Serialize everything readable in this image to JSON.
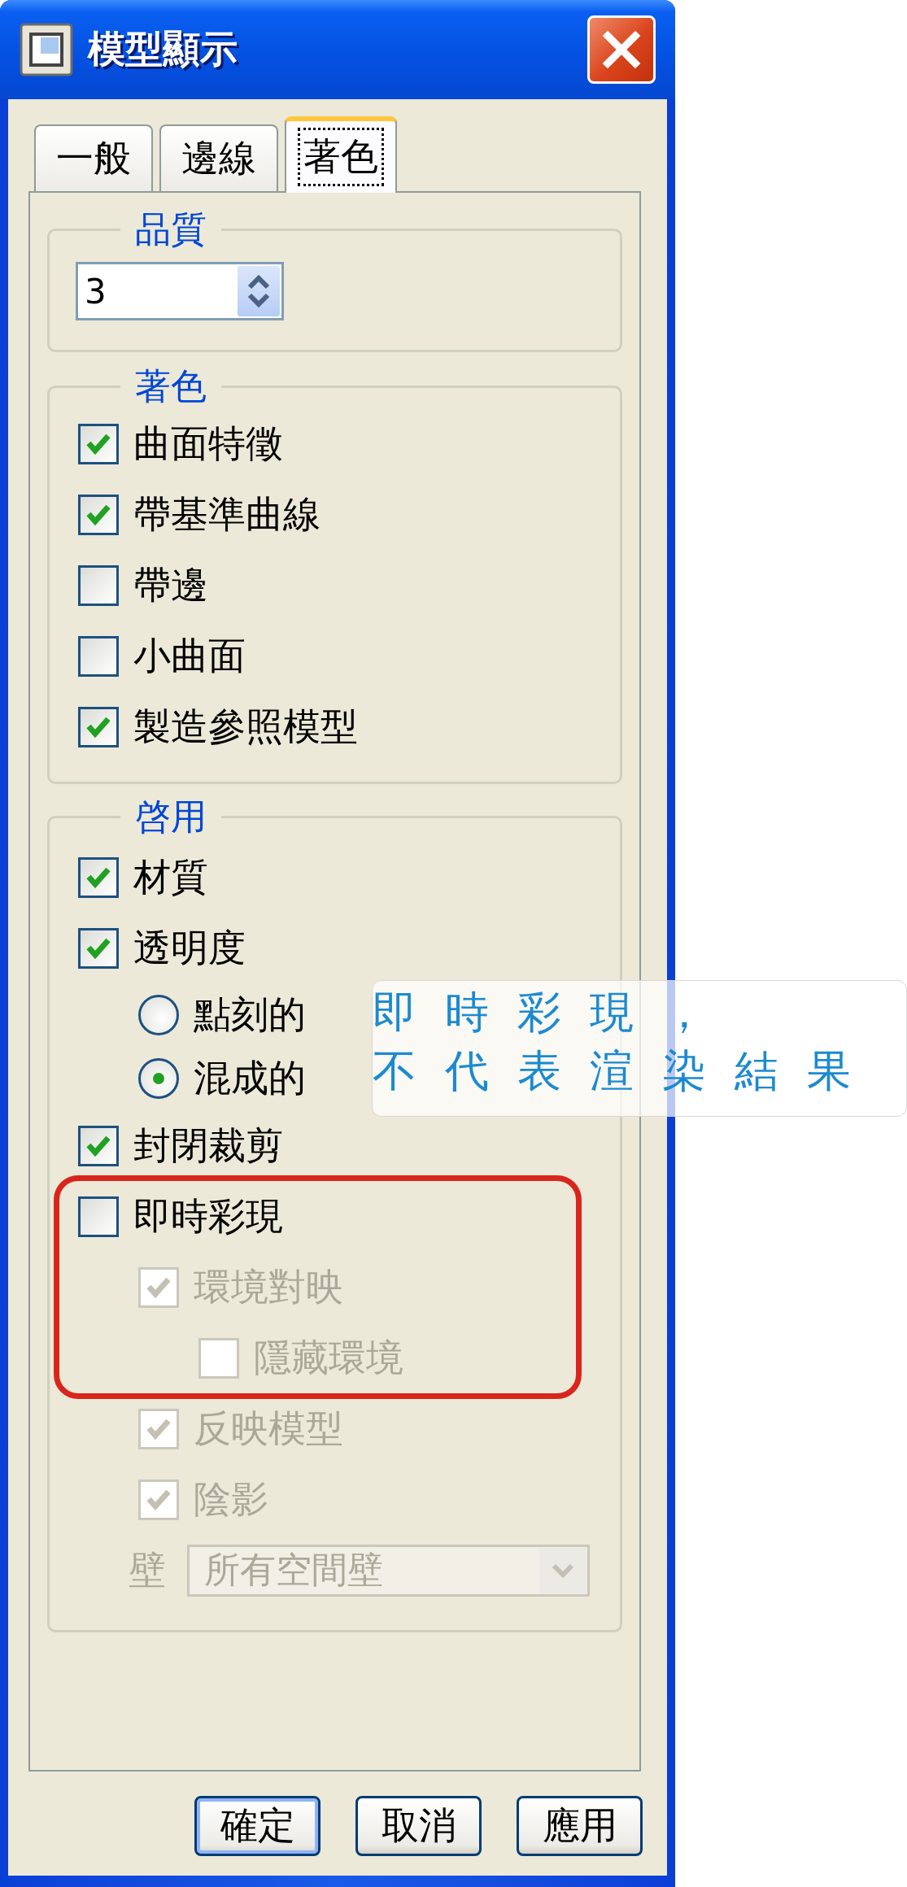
{
  "window": {
    "title": "模型顯示"
  },
  "tabs": [
    {
      "label": "一般",
      "selected": false
    },
    {
      "label": "邊線",
      "selected": false
    },
    {
      "label": "著色",
      "selected": true
    }
  ],
  "quality": {
    "legend": "品質",
    "value": "3"
  },
  "shading": {
    "legend": "著色",
    "items": [
      {
        "kind": "checkbox",
        "label": "曲面特徵",
        "checked": true,
        "disabled": false
      },
      {
        "kind": "checkbox",
        "label": "帶基準曲線",
        "checked": true,
        "disabled": false
      },
      {
        "kind": "checkbox",
        "label": "帶邊",
        "checked": false,
        "disabled": false
      },
      {
        "kind": "checkbox",
        "label": "小曲面",
        "checked": false,
        "disabled": false
      },
      {
        "kind": "checkbox",
        "label": "製造參照模型",
        "checked": true,
        "disabled": false
      }
    ]
  },
  "enable": {
    "legend": "啓用",
    "items": [
      {
        "kind": "checkbox",
        "label": "材質",
        "checked": true,
        "disabled": false,
        "highlighted": false
      },
      {
        "kind": "checkbox",
        "label": "透明度",
        "checked": true,
        "disabled": false,
        "highlighted": false,
        "children": [
          {
            "kind": "radio",
            "label": "點刻的",
            "selected": false,
            "disabled": false,
            "highlighted": false
          },
          {
            "kind": "radio",
            "label": "混成的",
            "selected": true,
            "disabled": false,
            "highlighted": false
          }
        ]
      },
      {
        "kind": "checkbox",
        "label": "封閉裁剪",
        "checked": true,
        "disabled": false,
        "highlighted": false
      },
      {
        "kind": "checkbox",
        "label": "即時彩現",
        "checked": false,
        "disabled": false,
        "highlighted": true,
        "children": [
          {
            "kind": "checkbox",
            "label": "環境對映",
            "checked": true,
            "disabled": true,
            "highlighted": true,
            "children": [
              {
                "kind": "checkbox",
                "label": "隱藏環境",
                "checked": false,
                "disabled": true,
                "highlighted": true
              }
            ]
          },
          {
            "kind": "checkbox",
            "label": "反映模型",
            "checked": true,
            "disabled": true,
            "highlighted": false
          },
          {
            "kind": "checkbox",
            "label": "陰影",
            "checked": true,
            "disabled": true,
            "highlighted": false
          }
        ]
      }
    ],
    "wall": {
      "label": "壁",
      "value": "所有空間壁",
      "disabled": true
    }
  },
  "buttons": [
    {
      "label": "確定",
      "default": true
    },
    {
      "label": "取消",
      "default": false
    },
    {
      "label": "應用",
      "default": false
    }
  ],
  "annotation": {
    "lines": [
      "即時彩現，",
      "不代表渲染結果"
    ]
  }
}
